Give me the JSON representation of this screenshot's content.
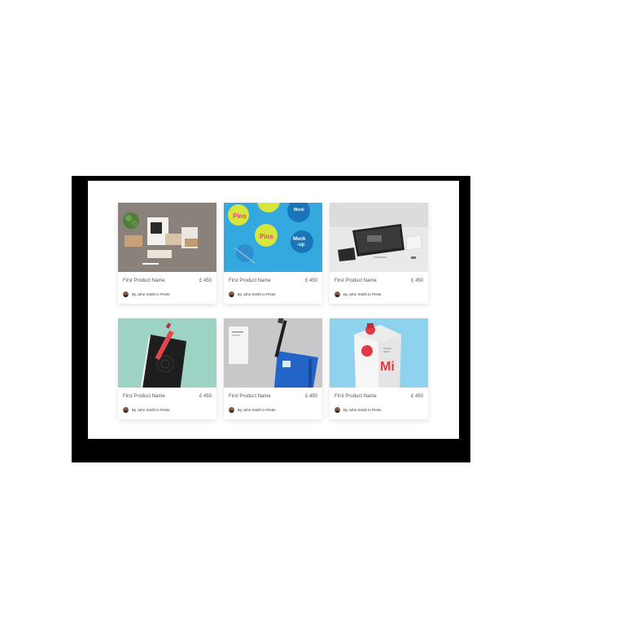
{
  "products": [
    {
      "name": "First Product Name",
      "price": "£ 450",
      "author": "By John Smith in Prints",
      "image": "stationery-mockup",
      "bg": "#8f8780"
    },
    {
      "name": "First Product Name",
      "price": "£ 450",
      "author": "By John Smith in Prints",
      "image": "pins-mockup",
      "bg": "#34a9e0"
    },
    {
      "name": "First Product Name",
      "price": "£ 450",
      "author": "By John Smith in Prints",
      "image": "website-devices-mockup",
      "bg": "#e9e9e9"
    },
    {
      "name": "First Product Name",
      "price": "£ 450",
      "author": "By John Smith in Prints",
      "image": "notebook-pen-mockup",
      "bg": "#9dd3c4"
    },
    {
      "name": "First Product Name",
      "price": "£ 450",
      "author": "By John Smith in Prints",
      "image": "business-card-pen-mockup",
      "bg": "#c8c8ca"
    },
    {
      "name": "First Product Name",
      "price": "£ 450",
      "author": "By John Smith in Prints",
      "image": "milk-carton-mockup",
      "bg": "#8ed2ee"
    }
  ]
}
